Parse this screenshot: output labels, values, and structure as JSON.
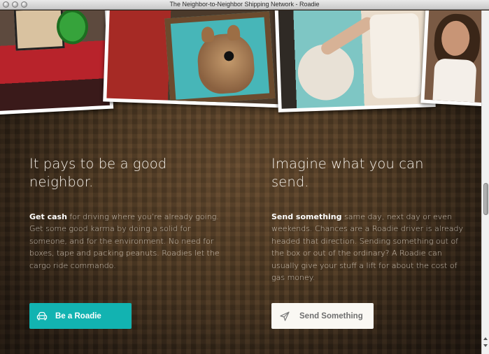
{
  "window": {
    "title": "The Neighbor-to-Neighbor Shipping Network - Roadie"
  },
  "left": {
    "heading": "It pays to be a good neighbor.",
    "lead": "Get cash",
    "body": " for driving where you’re already going. Get some good karma by doing a solid for someone, and for the environment. No need for boxes, tape and packing peanuts. Roadies let the cargo ride commando.",
    "button_label": "Be a Roadie",
    "button_icon": "car-icon"
  },
  "right": {
    "heading": "Imagine what you can send.",
    "lead": "Send something",
    "body": " same day, next day or even weekends. Chances are a Roadie driver is already headed that direction. Sending something out of the box or out of the ordinary? A Roadie can usually give your stuff a lift for about the cost of gas money.",
    "button_label": "Send Something",
    "button_icon": "paper-plane-icon"
  },
  "colors": {
    "accent_teal": "#12b3b1",
    "button_light": "#faf8f3",
    "background_brown": "#4b3822"
  }
}
